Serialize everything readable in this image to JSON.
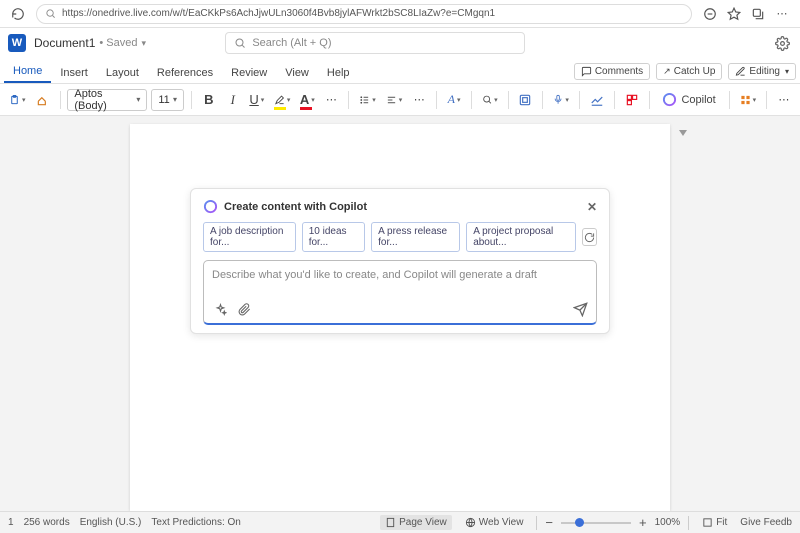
{
  "browser": {
    "url": "https://onedrive.live.com/w/t/EaCKkPs6AchJjwULn3060f4Bvb8jylAFWrkt2bSC8LIaZw?e=CMgqn1"
  },
  "titlebar": {
    "app_initial": "W",
    "doc_name": "Document1",
    "saved_label": "Saved",
    "search_placeholder": "Search (Alt + Q)"
  },
  "tabs": {
    "items": [
      "Home",
      "Insert",
      "Layout",
      "References",
      "Review",
      "View",
      "Help"
    ],
    "comments": "Comments",
    "catchup": "Catch Up",
    "editing": "Editing"
  },
  "ribbon": {
    "font_name": "Aptos (Body)",
    "font_size": "11",
    "copilot_label": "Copilot"
  },
  "copilot": {
    "title": "Create content with Copilot",
    "chips": [
      "A job description for...",
      "10 ideas for...",
      "A press release for...",
      "A project proposal about..."
    ],
    "placeholder": "Describe what you'd like to create, and Copilot will generate a draft"
  },
  "status": {
    "page_indicator": "1",
    "word_count": "256 words",
    "language": "English (U.S.)",
    "predictions": "Text Predictions: On",
    "page_view": "Page View",
    "web_view": "Web View",
    "zoom": "100%",
    "fit": "Fit",
    "feedback": "Give Feedb"
  }
}
